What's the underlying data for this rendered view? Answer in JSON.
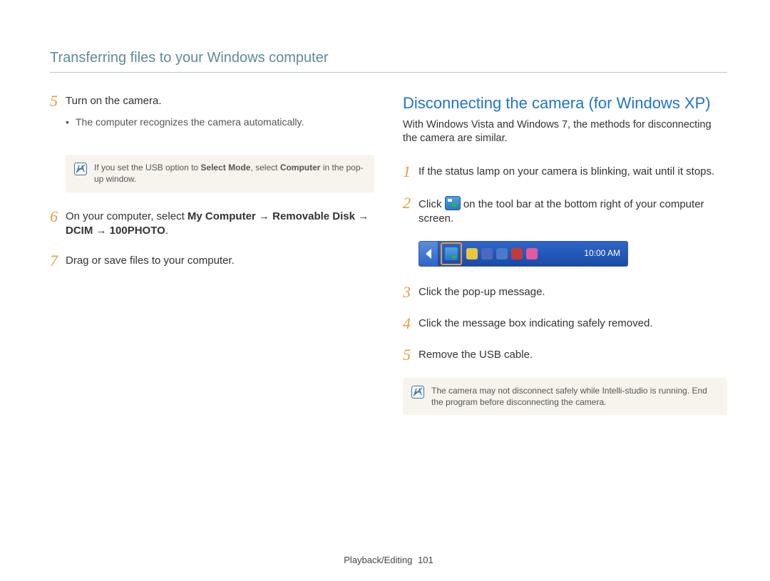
{
  "header": {
    "title": "Transferring files to your Windows computer"
  },
  "left": {
    "steps": [
      {
        "num": "5",
        "text": "Turn on the camera.",
        "sub": "The computer recognizes the camera automatically.",
        "note_parts": {
          "a": "If you set the USB option to ",
          "b": "Select Mode",
          "c": ", select ",
          "d": "Computer",
          "e": " in the pop-up window."
        }
      },
      {
        "num": "6",
        "parts": {
          "a": "On your computer, select ",
          "b": "My Computer",
          "c": " → ",
          "d": "Removable Disk",
          "e": " → ",
          "f": "DCIM",
          "g": " → ",
          "h": "100PHOTO",
          "i": "."
        }
      },
      {
        "num": "7",
        "text": "Drag or save files to your computer."
      }
    ]
  },
  "right": {
    "heading": "Disconnecting the camera (for Windows XP)",
    "intro": "With Windows Vista and Windows 7, the methods for disconnecting the camera are similar.",
    "steps": [
      {
        "num": "1",
        "text": "If the status lamp on your camera is blinking, wait until it stops."
      },
      {
        "num": "2",
        "parts": {
          "a": "Click ",
          "b": " on the tool bar at the bottom right of your computer screen."
        }
      },
      {
        "num": "3",
        "text": "Click the pop-up message."
      },
      {
        "num": "4",
        "text": "Click the message box indicating safely removed."
      },
      {
        "num": "5",
        "text": "Remove the USB cable."
      }
    ],
    "tray": {
      "time": "10:00 AM"
    },
    "note": "The camera may not disconnect safely while Intelli-studio is running. End the program before disconnecting the camera."
  },
  "footer": {
    "section": "Playback/Editing",
    "page": "101"
  }
}
